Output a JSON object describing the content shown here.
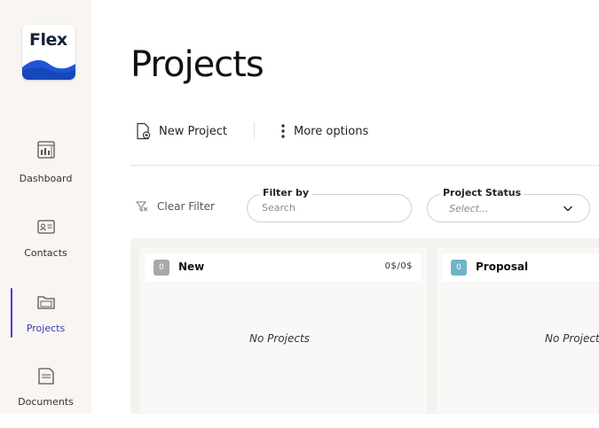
{
  "app": {
    "logo_text": "Flex",
    "brand_color": "#1f55d6"
  },
  "sidebar": {
    "items": [
      {
        "label": "Dashboard",
        "icon": "dashboard-icon"
      },
      {
        "label": "Contacts",
        "icon": "contact-card-icon"
      },
      {
        "label": "Projects",
        "icon": "folder-icon",
        "active": true
      },
      {
        "label": "Documents",
        "icon": "document-icon"
      }
    ],
    "active_color": "#4b3fd0"
  },
  "page": {
    "title": "Projects"
  },
  "toolbar": {
    "new_project_label": "New Project",
    "more_options_label": "More options"
  },
  "filters": {
    "clear_filter_label": "Clear Filter",
    "filter_by": {
      "label": "Filter by",
      "placeholder": "Search"
    },
    "project_status": {
      "label": "Project Status",
      "value": "Select..."
    }
  },
  "board": {
    "columns": [
      {
        "title": "New",
        "badge": "0",
        "badge_color": "#a8a8a8",
        "amount": "0$/0$",
        "empty_text": "No Projects"
      },
      {
        "title": "Proposal",
        "badge": "0",
        "badge_color": "#6fb4c4",
        "amount": "",
        "empty_text": "No Projects"
      }
    ]
  }
}
